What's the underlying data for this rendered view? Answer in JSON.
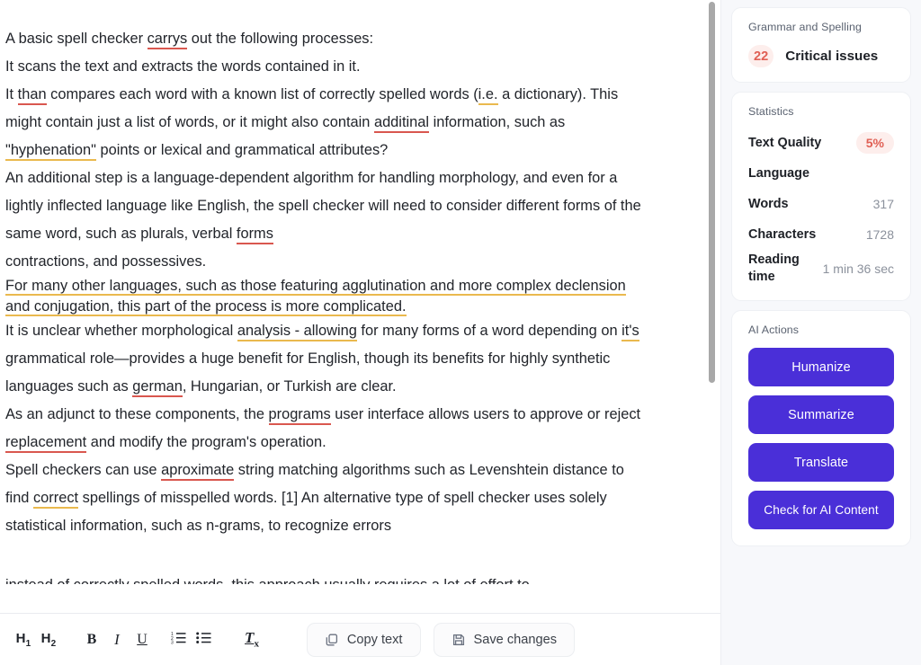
{
  "editor": {
    "paragraphs": [
      {
        "id": "p1",
        "runs": [
          {
            "t": "A basic spell checker "
          },
          {
            "t": "carrys",
            "mark": "red"
          },
          {
            "t": " out the following processes:"
          }
        ]
      },
      {
        "id": "p2",
        "runs": [
          {
            "t": "It scans the text and extracts the words contained in it."
          }
        ]
      },
      {
        "id": "p3",
        "runs": [
          {
            "t": "It "
          },
          {
            "t": "than",
            "mark": "red"
          },
          {
            "t": " compares each word with a known list of correctly spelled words ("
          },
          {
            "t": "i.e.",
            "mark": "yellow"
          },
          {
            "t": " a dictionary). This might contain just a list of words, or it might also contain "
          },
          {
            "t": "additinal",
            "mark": "red"
          },
          {
            "t": " information, such as "
          },
          {
            "t": "\"hyphenation\"",
            "mark": "yellow"
          },
          {
            "t": " points or lexical and grammatical attributes?"
          }
        ]
      },
      {
        "id": "p4",
        "runs": [
          {
            "t": "An additional step is a language-dependent algorithm for handling morphology, and even for a lightly inflected language like English, the spell checker will need to consider different forms of the same word, such as plurals, verbal "
          },
          {
            "t": "forms",
            "mark": "red"
          }
        ]
      },
      {
        "id": "p5",
        "runs": [
          {
            "t": "contractions, and possessives."
          }
        ]
      },
      {
        "id": "p6",
        "tight": true,
        "runs": [
          {
            "t": "For many other languages, such as those featuring agglutination and more complex declension and conjugation, this part of the process is more complicated.",
            "mark": "yellow-block"
          }
        ]
      },
      {
        "id": "p7",
        "runs": [
          {
            "t": "It is unclear whether morphological "
          },
          {
            "t": "analysis - allowing",
            "mark": "yellow"
          },
          {
            "t": " for many forms of a word depending on "
          },
          {
            "t": "it's",
            "mark": "yellow"
          },
          {
            "t": " grammatical role—provides a huge benefit for English, though its benefits for highly synthetic languages such as "
          },
          {
            "t": "german",
            "mark": "red"
          },
          {
            "t": ", Hungarian, or Turkish are clear."
          }
        ]
      },
      {
        "id": "p8",
        "runs": [
          {
            "t": "As an adjunct to these components, the "
          },
          {
            "t": "programs",
            "mark": "red"
          },
          {
            "t": " user interface allows users to approve or reject "
          },
          {
            "t": "replacement",
            "mark": "red"
          },
          {
            "t": " and modify the program's operation."
          }
        ]
      },
      {
        "id": "p9",
        "runs": [
          {
            "t": "Spell checkers can use "
          },
          {
            "t": "aproximate",
            "mark": "red"
          },
          {
            "t": " string matching algorithms such as Levenshtein distance to find "
          },
          {
            "t": "correct",
            "mark": "yellow"
          },
          {
            "t": " spellings of misspelled words. [1] An alternative type of spell checker uses solely statistical information, such as n-grams, to recognize errors"
          }
        ]
      }
    ],
    "clipped_line": "instead of correctly spelled words, this approach usually requires a lot of effort to"
  },
  "toolbar": {
    "heading1_label": "H",
    "heading1_sub": "1",
    "heading2_label": "H",
    "heading2_sub": "2",
    "bold_label": "B",
    "italic_label": "I",
    "underline_label": "U",
    "clear_format_label": "T",
    "clear_format_sub": "x",
    "copy_text_label": "Copy text",
    "save_changes_label": "Save changes"
  },
  "sidebar": {
    "grammar": {
      "title": "Grammar and Spelling",
      "count": "22",
      "label": "Critical issues"
    },
    "statistics": {
      "title": "Statistics",
      "rows": [
        {
          "label": "Text Quality",
          "value": "5%",
          "style": "pill"
        },
        {
          "label": "Language",
          "value": "",
          "style": "plain"
        },
        {
          "label": "Words",
          "value": "317",
          "style": "plain"
        },
        {
          "label": "Characters",
          "value": "1728",
          "style": "plain"
        },
        {
          "label": "Reading time",
          "value": "1 min 36 sec",
          "style": "plain"
        }
      ]
    },
    "ai_actions": {
      "title": "AI Actions",
      "buttons": [
        {
          "label": "Humanize"
        },
        {
          "label": "Summarize"
        },
        {
          "label": "Translate"
        },
        {
          "label": "Check for AI Content"
        }
      ]
    }
  },
  "colors": {
    "accent_purple": "#4a2fd8",
    "error_red": "#d9574f",
    "warning_yellow": "#eab94e",
    "badge_bg": "#fdeeec",
    "badge_text": "#e06055",
    "sidebar_bg": "#f7f8fb"
  }
}
